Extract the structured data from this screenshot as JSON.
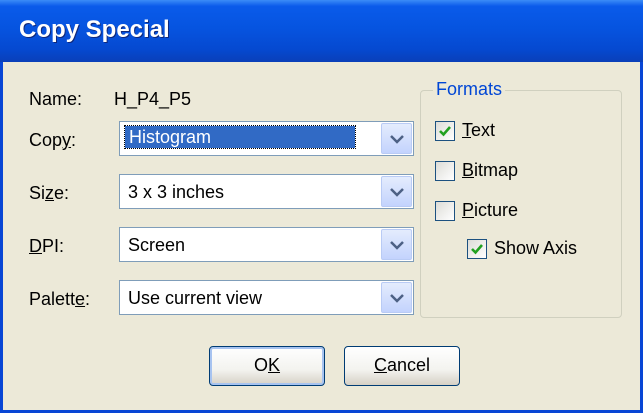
{
  "window": {
    "title": "Copy Special"
  },
  "name": {
    "label": "Name:",
    "value": "H_P4_P5"
  },
  "fields": {
    "copy": {
      "label_pre": "Cop",
      "label_key": "y",
      "label_post": ":",
      "value": "Histogram"
    },
    "size": {
      "label_pre": "Si",
      "label_key": "z",
      "label_post": "e:",
      "value": "3 x 3 inches"
    },
    "dpi": {
      "label_pre": "",
      "label_key": "D",
      "label_post": "PI:",
      "value": "Screen"
    },
    "palette": {
      "label_pre": "Palett",
      "label_key": "e",
      "label_post": ":",
      "value": "Use current view"
    }
  },
  "formats": {
    "title": "Formats",
    "text": {
      "key": "T",
      "rest": "ext",
      "checked": true
    },
    "bitmap": {
      "key": "B",
      "rest": "itmap",
      "checked": false
    },
    "picture": {
      "key": "P",
      "rest": "icture",
      "checked": false
    },
    "show_axis": {
      "label": "Show Axis",
      "checked": true
    }
  },
  "buttons": {
    "ok": {
      "key": "K",
      "pre": "O"
    },
    "cancel": {
      "key": "C",
      "rest": "ancel"
    }
  },
  "colors": {
    "title_bar": "#0654e0",
    "accent": "#316ac5",
    "group_title": "#0046d5"
  },
  "icons": {
    "dropdown": "chevron-down-icon",
    "check": "checkmark-icon"
  }
}
